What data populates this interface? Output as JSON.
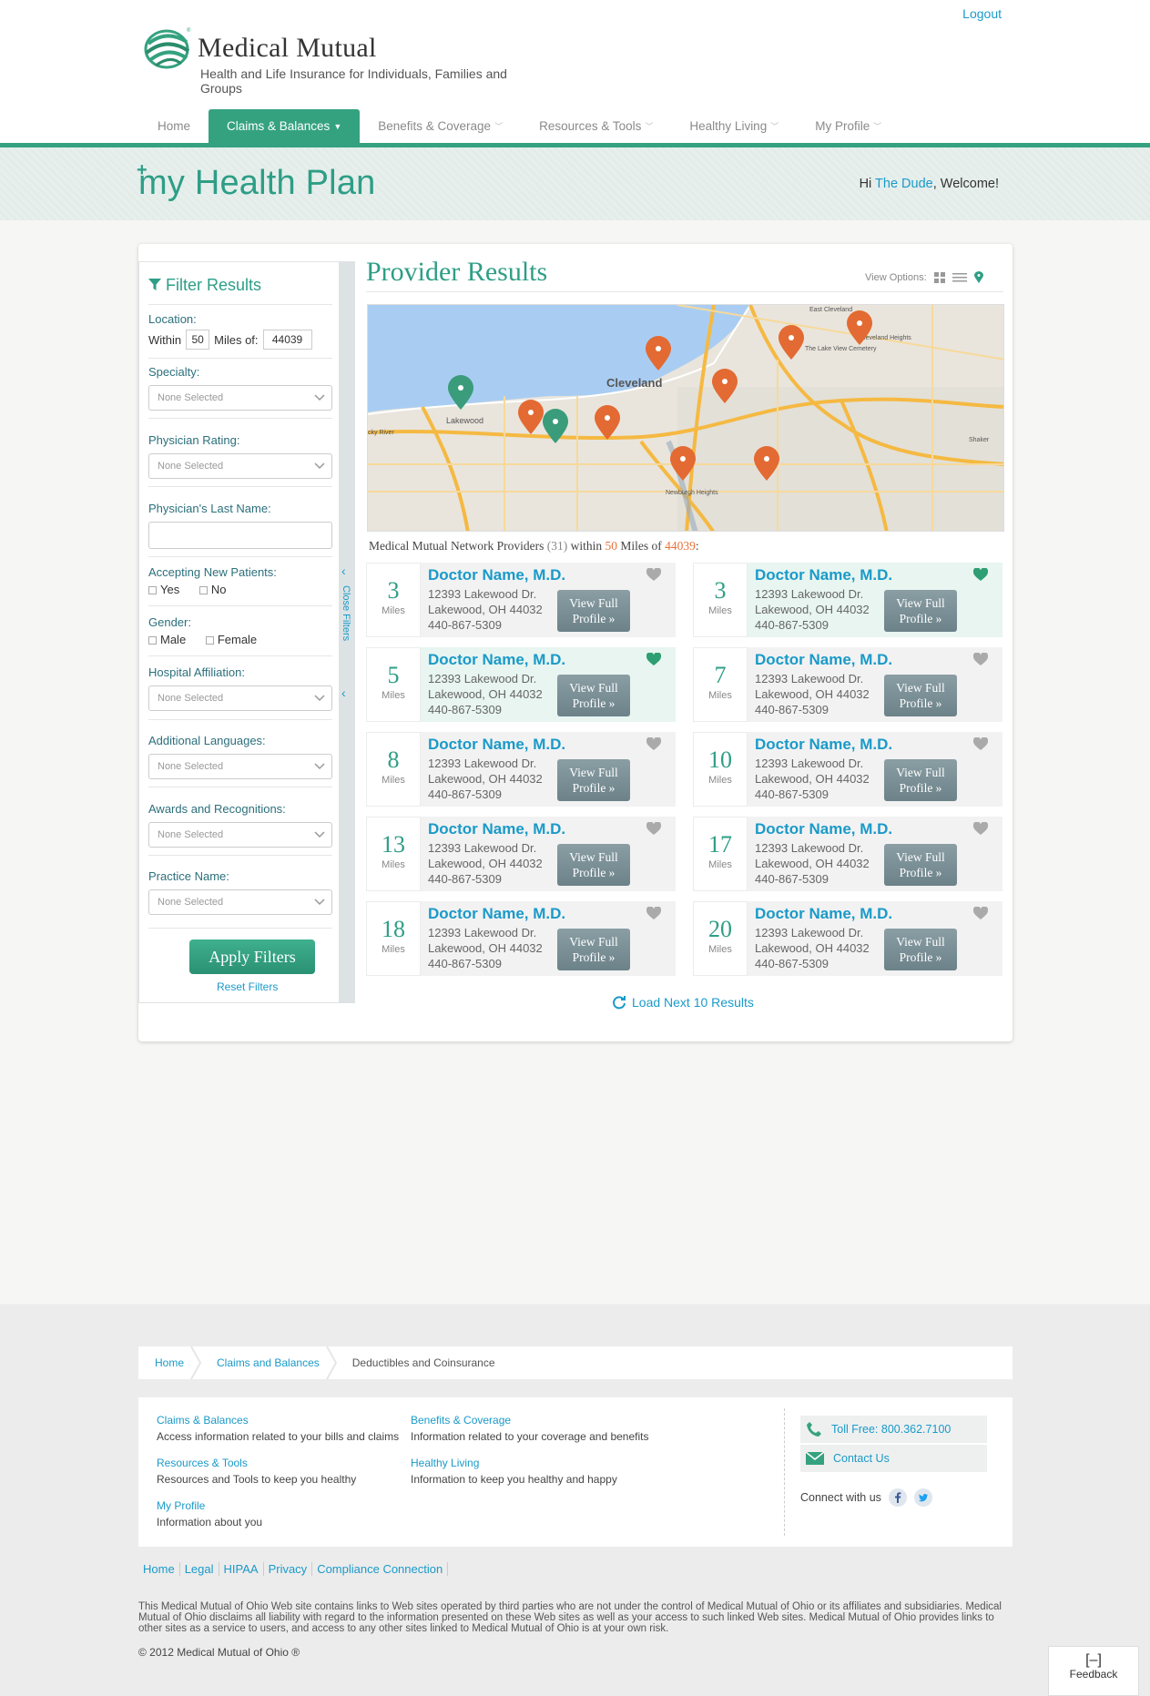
{
  "header": {
    "logout_label": "Logout",
    "brand_name": "Medical Mutual",
    "brand_tagline": "Health and Life Insurance for Individuals, Families and Groups",
    "colors": {
      "primary": "#35a27f",
      "link": "#1a9ac9",
      "accent": "#e8733c"
    }
  },
  "nav": {
    "items": [
      {
        "label": "Home"
      },
      {
        "label": "Claims & Balances",
        "active": true
      },
      {
        "label": "Benefits & Coverage"
      },
      {
        "label": "Resources & Tools"
      },
      {
        "label": "Healthy Living"
      },
      {
        "label": "My Profile"
      }
    ]
  },
  "banner": {
    "plan_my": "my",
    "plan_rest": "Health Plan",
    "welcome_prefix": "Hi",
    "user_name": "The Dude",
    "welcome_suffix": ", Welcome!"
  },
  "filters": {
    "title": "Filter Results",
    "location_label": "Location:",
    "within_label": "Within",
    "within_value": "50",
    "miles_of_label": "Miles of:",
    "zip_value": "44039",
    "specialty_label": "Specialty:",
    "rating_label": "Physician Rating:",
    "lastname_label": "Physician's Last Name:",
    "lastname_value": "",
    "new_patients_label": "Accepting New Patients:",
    "yes_label": "Yes",
    "no_label": "No",
    "gender_label": "Gender:",
    "male_label": "Male",
    "female_label": "Female",
    "hospital_label": "Hospital Affiliation:",
    "languages_label": "Additional Languages:",
    "awards_label": "Awards and Recognitions:",
    "practice_label": "Practice Name:",
    "none_selected": "None Selected",
    "apply_label": "Apply Filters",
    "reset_label": "Reset Filters",
    "close_filters_label": "Close Filters"
  },
  "results": {
    "title": "Provider Results",
    "view_options_label": "View Options:",
    "summary": {
      "prefix": "Medical Mutual Network Providers",
      "count": "(31)",
      "within": "within",
      "miles": "50",
      "miles_of": "Miles of",
      "zip": "44039",
      "end": ":"
    },
    "map_city_label": "Cleveland",
    "map_labels": {
      "lakewood": "Lakewood",
      "east_cleveland": "East Cleveland",
      "cleveland_heights": "Cleveland Heights",
      "newburgh": "Newburgh Heights",
      "rocky": "cky River",
      "view_cemetery": "The Lake View Cemetery",
      "shaker": "Shaker"
    },
    "view_profile_label": "View Full Profile »",
    "miles_unit": "Miles",
    "items": [
      {
        "distance": "3",
        "name": "Doctor Name, M.D.",
        "street": "12393 Lakewood Dr.",
        "city": "Lakewood, OH 44032",
        "phone": "440-867-5309",
        "favorite": false
      },
      {
        "distance": "3",
        "name": "Doctor Name, M.D.",
        "street": "12393 Lakewood Dr.",
        "city": "Lakewood, OH 44032",
        "phone": "440-867-5309",
        "favorite": true
      },
      {
        "distance": "5",
        "name": "Doctor Name, M.D.",
        "street": "12393 Lakewood Dr.",
        "city": "Lakewood, OH 44032",
        "phone": "440-867-5309",
        "favorite": true
      },
      {
        "distance": "7",
        "name": "Doctor Name, M.D.",
        "street": "12393 Lakewood Dr.",
        "city": "Lakewood, OH 44032",
        "phone": "440-867-5309",
        "favorite": false
      },
      {
        "distance": "8",
        "name": "Doctor Name, M.D.",
        "street": "12393 Lakewood Dr.",
        "city": "Lakewood, OH 44032",
        "phone": "440-867-5309",
        "favorite": false
      },
      {
        "distance": "10",
        "name": "Doctor Name, M.D.",
        "street": "12393 Lakewood Dr.",
        "city": "Lakewood, OH 44032",
        "phone": "440-867-5309",
        "favorite": false
      },
      {
        "distance": "13",
        "name": "Doctor Name, M.D.",
        "street": "12393 Lakewood Dr.",
        "city": "Lakewood, OH 44032",
        "phone": "440-867-5309",
        "favorite": false
      },
      {
        "distance": "17",
        "name": "Doctor Name, M.D.",
        "street": "12393 Lakewood Dr.",
        "city": "Lakewood, OH 44032",
        "phone": "440-867-5309",
        "favorite": false
      },
      {
        "distance": "18",
        "name": "Doctor Name, M.D.",
        "street": "12393 Lakewood Dr.",
        "city": "Lakewood, OH 44032",
        "phone": "440-867-5309",
        "favorite": false
      },
      {
        "distance": "20",
        "name": "Doctor Name, M.D.",
        "street": "12393 Lakewood Dr.",
        "city": "Lakewood, OH 44032",
        "phone": "440-867-5309",
        "favorite": false
      }
    ],
    "load_next_label": "Load Next 10 Results"
  },
  "footer": {
    "breadcrumb": [
      {
        "label": "Home"
      },
      {
        "label": "Claims and Balances"
      },
      {
        "label": "Deductibles and Coinsurance"
      }
    ],
    "links": [
      {
        "title": "Claims & Balances",
        "desc": "Access information related to your bills and claims"
      },
      {
        "title": "Benefits & Coverage",
        "desc": "Information related to your coverage and benefits"
      },
      {
        "title": "Resources & Tools",
        "desc": "Resources and Tools to keep you healthy"
      },
      {
        "title": "Healthy Living",
        "desc": "Information to keep you healthy and happy"
      },
      {
        "title": "My Profile",
        "desc": "Information about you"
      }
    ],
    "toll_free": "Toll Free: 800.362.7100",
    "contact_us": "Contact Us",
    "connect_label": "Connect with us",
    "bottom_links": [
      "Home",
      "Legal",
      "HIPAA",
      "Privacy",
      "Compliance Connection"
    ],
    "disclaimer": "This Medical Mutual of Ohio Web site contains links to Web sites operated by third parties who are not under the control of Medical Mutual of Ohio or its affiliates and subsidiaries. Medical Mutual of Ohio disclaims all liability with regard to the information presented on these Web sites as well as your access to such linked Web sites. Medical Mutual of Ohio provides links to other sites as a service to users, and access to any other sites linked to Medical Mutual of Ohio is at your own risk.",
    "copyright": "© 2012 Medical Mutual of Ohio ®",
    "feedback_label": "Feedback",
    "feedback_icon": "[–]"
  }
}
